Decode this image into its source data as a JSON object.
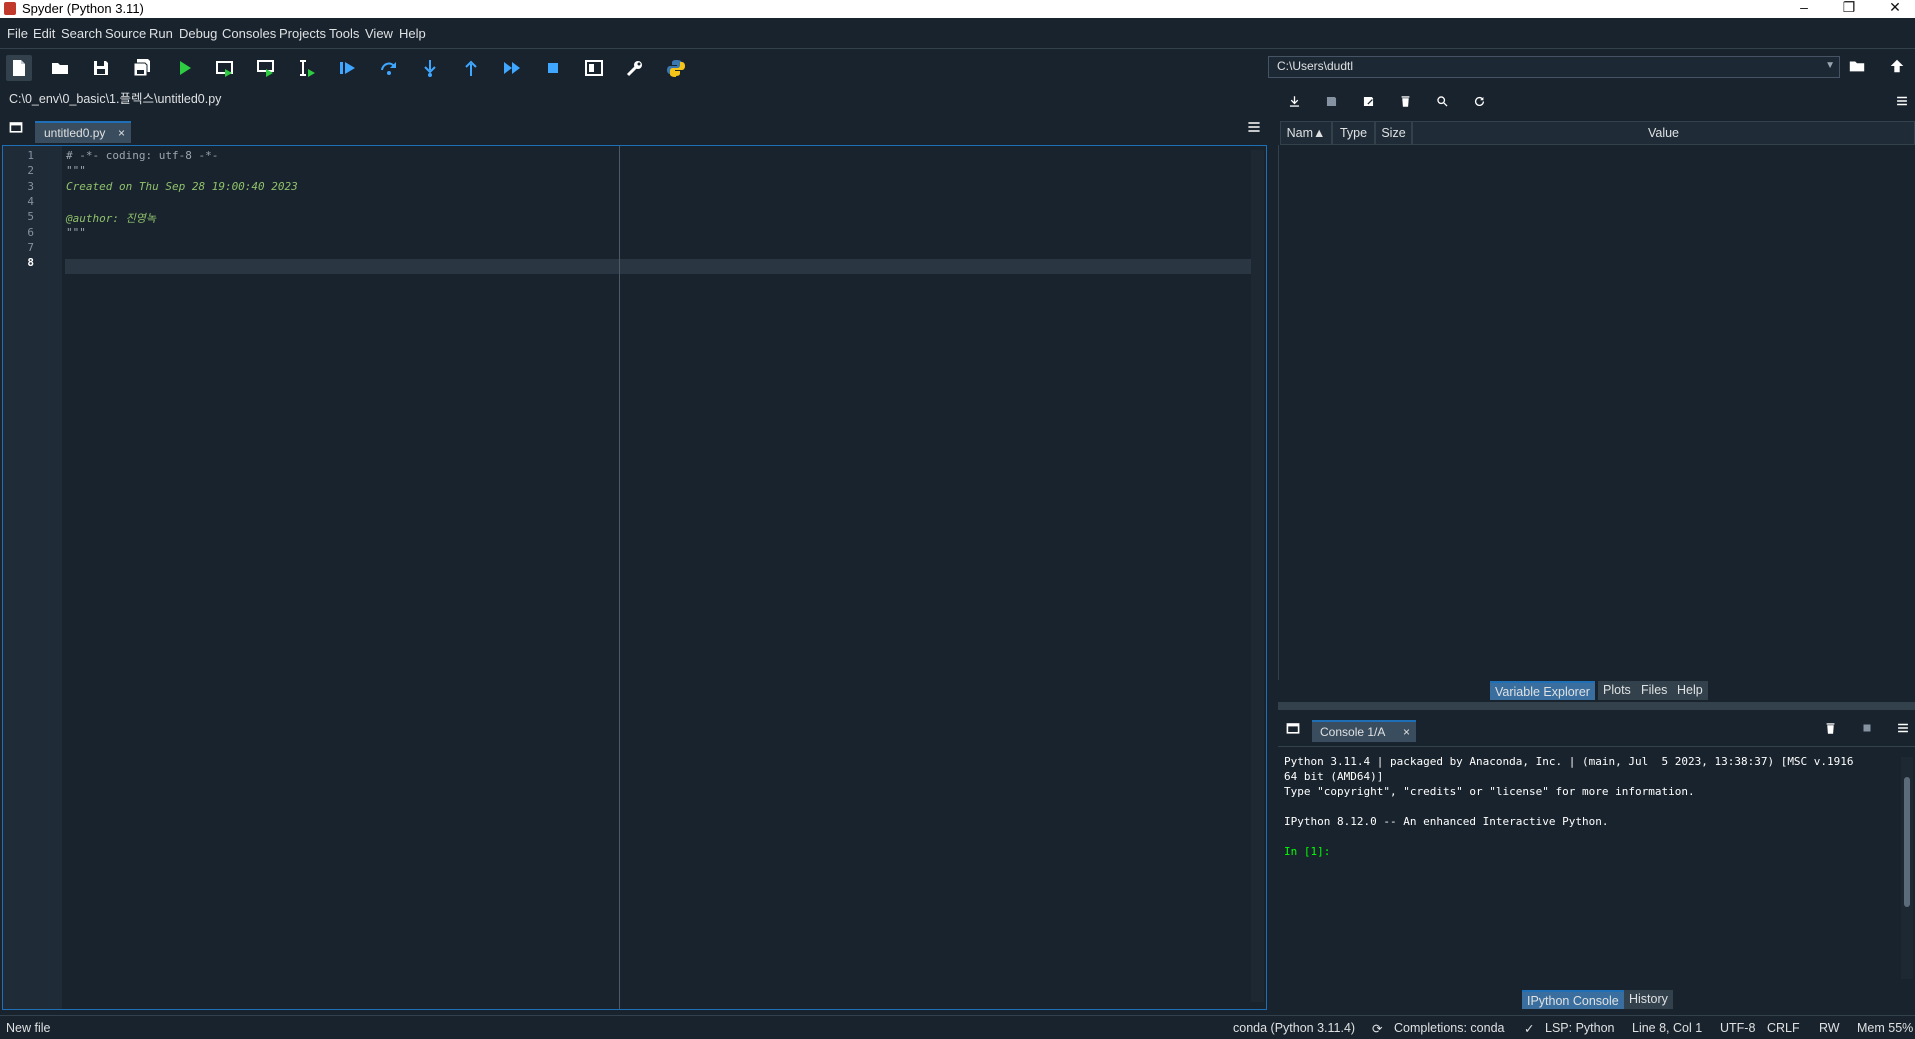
{
  "window": {
    "title": "Spyder (Python 3.11)",
    "minimize": "–",
    "restore": "❐",
    "close": "✕"
  },
  "menu": [
    "File",
    "Edit",
    "Search",
    "Source",
    "Run",
    "Debug",
    "Consoles",
    "Projects",
    "Tools",
    "View",
    "Help"
  ],
  "toolbar": {
    "icons": [
      "new-file-icon",
      "open-folder-icon",
      "save-icon",
      "save-all-icon",
      "run-icon",
      "run-cell-icon",
      "run-cell-advance-icon",
      "run-selection-icon",
      "debug-icon",
      "step-over-icon",
      "step-into-icon",
      "step-return-icon",
      "continue-icon",
      "stop-icon",
      "maximize-pane-icon",
      "preferences-icon",
      "python-path-icon"
    ],
    "working_directory": "C:\\Users\\dudtl"
  },
  "editor": {
    "file_path": "C:\\0_env\\0_basic\\1.플렉스\\untitled0.py",
    "tab_label": "untitled0.py",
    "tab_close": "×",
    "lines": [
      {
        "num": "1",
        "text": "# -*- coding: utf-8 -*-",
        "color": "#9aa6b1"
      },
      {
        "num": "2",
        "text": "\"\"\"",
        "color": "#9aa6b1"
      },
      {
        "num": "3",
        "text": "Created on Thu Sep 28 19:00:40 2023",
        "color": "#8fc16b"
      },
      {
        "num": "4",
        "text": "",
        "color": "#8fc16b"
      },
      {
        "num": "5",
        "text": "@author: 진영녹",
        "color": "#8fc16b"
      },
      {
        "num": "6",
        "text": "\"\"\"",
        "color": "#9aa6b1"
      },
      {
        "num": "7",
        "text": "",
        "color": "#9aa6b1"
      },
      {
        "num": "8",
        "text": "",
        "color": "#ffffff"
      }
    ],
    "current_line": "8"
  },
  "variable_explorer": {
    "columns": [
      "Nam▲",
      "Type",
      "Size",
      "Value"
    ]
  },
  "top_right_tabs": [
    "Variable Explorer",
    "Plots",
    "Files",
    "Help"
  ],
  "console": {
    "tab_label": "Console 1/A",
    "tab_close": "×",
    "lines": [
      "Python 3.11.4 | packaged by Anaconda, Inc. | (main, Jul  5 2023, 13:38:37) [MSC v.1916",
      "64 bit (AMD64)]",
      "Type \"copyright\", \"credits\" or \"license\" for more information.",
      "",
      "IPython 8.12.0 -- An enhanced Interactive Python.",
      "",
      "In [1]:"
    ]
  },
  "bottom_right_tabs": [
    "IPython Console",
    "History"
  ],
  "status": {
    "message": "New file",
    "env": "conda (Python 3.11.4)",
    "completions": "Completions: conda",
    "lsp": "LSP: Python",
    "position": "Line 8, Col 1",
    "encoding": "UTF-8",
    "eol": "CRLF",
    "mode": "RW",
    "memory": "Mem 55%"
  },
  "colors": {
    "background": "#19232d",
    "accent": "#1e6fb5",
    "docstring": "#8fc16b",
    "prompt": "#00ff00"
  }
}
